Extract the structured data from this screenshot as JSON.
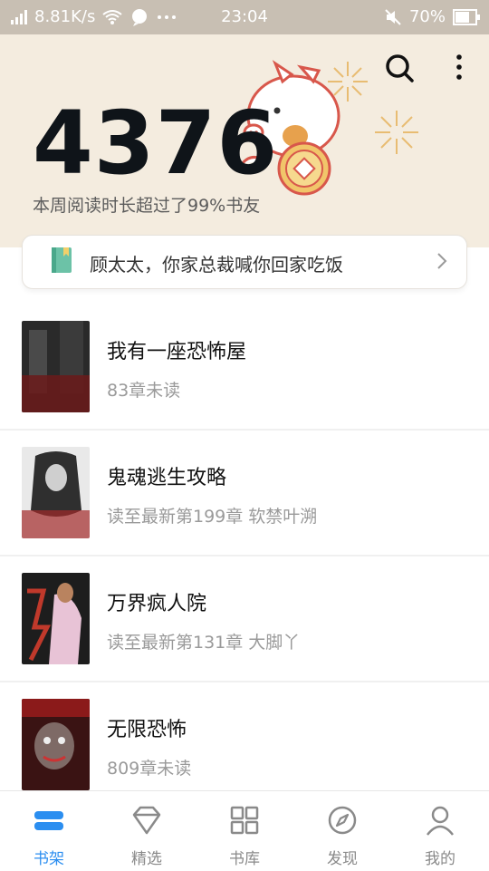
{
  "status_bar": {
    "speed": "8.81K/s",
    "time": "23:04",
    "battery": "70%"
  },
  "header": {
    "reading_minutes": "4376",
    "reading_summary": "本周阅读时长超过了99%书友",
    "icons": [
      "search-icon",
      "more-icon"
    ]
  },
  "notice": {
    "text": "顾太太，你家总裁喊你回家吃饭",
    "icon": "book-icon"
  },
  "books": [
    {
      "title": "我有一座恐怖屋",
      "meta": "83章未读"
    },
    {
      "title": "鬼魂逃生攻略",
      "meta": "读至最新第199章 软禁叶溯"
    },
    {
      "title": "万界疯人院",
      "meta": "读至最新第131章 大脚丫"
    },
    {
      "title": "无限恐怖",
      "meta": "809章未读"
    }
  ],
  "tabbar": [
    {
      "label": "书架",
      "icon": "bookshelf-icon",
      "active": true
    },
    {
      "label": "精选",
      "icon": "diamond-icon",
      "active": false
    },
    {
      "label": "书库",
      "icon": "grid-icon",
      "active": false
    },
    {
      "label": "发现",
      "icon": "compass-icon",
      "active": false
    },
    {
      "label": "我的",
      "icon": "user-icon",
      "active": false
    }
  ],
  "colors": {
    "accent": "#2b8ef0",
    "hero_bg": "#f4ecdf",
    "status_bg": "#c8bfb3"
  }
}
